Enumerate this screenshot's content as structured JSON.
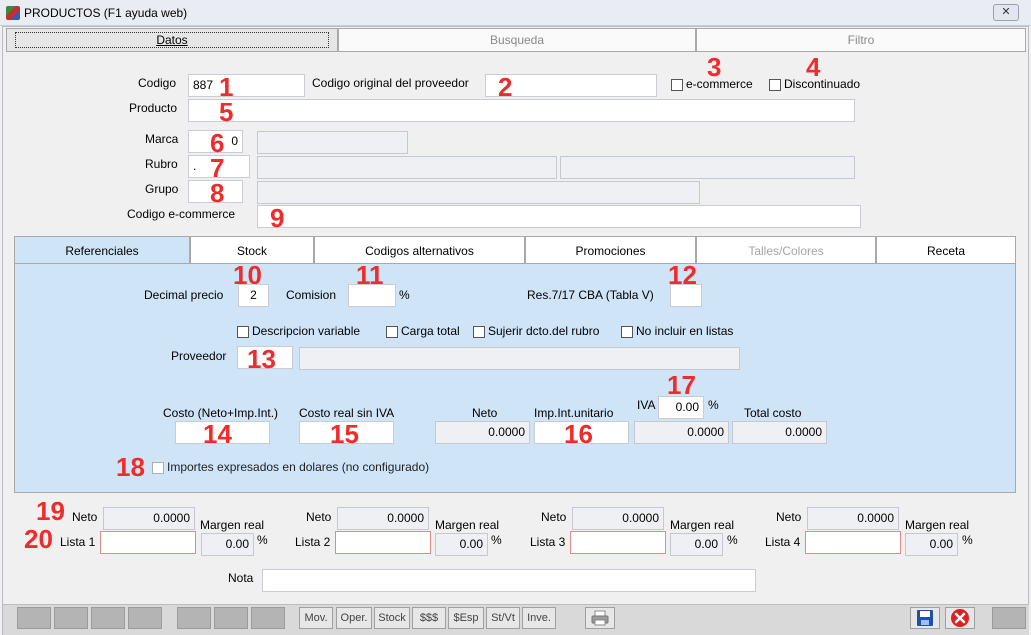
{
  "window": {
    "title": "PRODUCTOS (F1 ayuda web)",
    "close_icon": "✕"
  },
  "top_tabs": [
    "Datos",
    "Busqueda",
    "Filtro"
  ],
  "form": {
    "codigo_label": "Codigo",
    "codigo_value": "887",
    "codigo_orig_label": "Codigo original del proveedor",
    "codigo_orig_value": "",
    "ecommerce_label": "e-commerce",
    "discontinuado_label": "Discontinuado",
    "producto_label": "Producto",
    "producto_value": "",
    "marca_label": "Marca",
    "marca_value": "0",
    "marca_desc": "",
    "rubro_label": "Rubro",
    "rubro_value": ".",
    "rubro_desc": "",
    "rubro_desc2": "",
    "grupo_label": "Grupo",
    "grupo_value": "",
    "grupo_desc": "",
    "codigo_ecommerce_label": "Codigo e-commerce",
    "codigo_ecommerce_value": ""
  },
  "inner_tabs": [
    "Referenciales",
    "Stock",
    "Codigos alternativos",
    "Promociones",
    "Talles/Colores",
    "Receta"
  ],
  "ref": {
    "decimal_label": "Decimal precio",
    "decimal_value": "2",
    "comision_label": "Comision",
    "comision_value": "",
    "pct": "%",
    "res_label": "Res.7/17 CBA (Tabla V)",
    "res_value": "",
    "desc_var_label": "Descripcion variable",
    "carga_total_label": "Carga total",
    "sugerir_label": "Sujerir dcto.del rubro",
    "no_incluir_label": "No incluir en listas",
    "proveedor_label": "Proveedor",
    "proveedor_value": "",
    "proveedor_desc": "",
    "costo_label": "Costo (Neto+Imp.Int.)",
    "costo_value": "",
    "costo_real_label": "Costo real sin IVA",
    "costo_real_value": "",
    "neto_label": "Neto",
    "neto_value": "0.0000",
    "imp_label": "Imp.Int.unitario",
    "imp_value": "",
    "iva_label": "IVA",
    "iva_value": "0.00",
    "iva_total": "0.0000",
    "total_label": "Total costo",
    "total_value": "0.0000",
    "dolares_label": "Importes expresados en dolares (no configurado)"
  },
  "listas": [
    {
      "neto_label": "Neto",
      "neto_value": "0.0000",
      "lista_label": "Lista 1",
      "lista_value": "",
      "margen_label": "Margen real",
      "margen_value": "0.00",
      "pct": "%"
    },
    {
      "neto_label": "Neto",
      "neto_value": "0.0000",
      "lista_label": "Lista 2",
      "lista_value": "",
      "margen_label": "Margen real",
      "margen_value": "0.00",
      "pct": "%"
    },
    {
      "neto_label": "Neto",
      "neto_value": "0.0000",
      "lista_label": "Lista 3",
      "lista_value": "",
      "margen_label": "Margen real",
      "margen_value": "0.00",
      "pct": "%"
    },
    {
      "neto_label": "Neto",
      "neto_value": "0.0000",
      "lista_label": "Lista 4",
      "lista_value": "",
      "margen_label": "Margen real",
      "margen_value": "0.00",
      "pct": "%"
    }
  ],
  "nota_label": "Nota",
  "nota_value": "",
  "toolbar": [
    "Mov.",
    "Oper.",
    "Stock",
    "$$$",
    "$Esp",
    "St/Vt",
    "Inve."
  ],
  "markers": [
    "1",
    "2",
    "3",
    "4",
    "5",
    "6",
    "7",
    "8",
    "9",
    "10",
    "11",
    "12",
    "13",
    "14",
    "15",
    "16",
    "17",
    "18",
    "19",
    "20"
  ],
  "icons": [
    "app-icon",
    "close-icon",
    "print-icon",
    "save-icon",
    "cancel-icon"
  ]
}
